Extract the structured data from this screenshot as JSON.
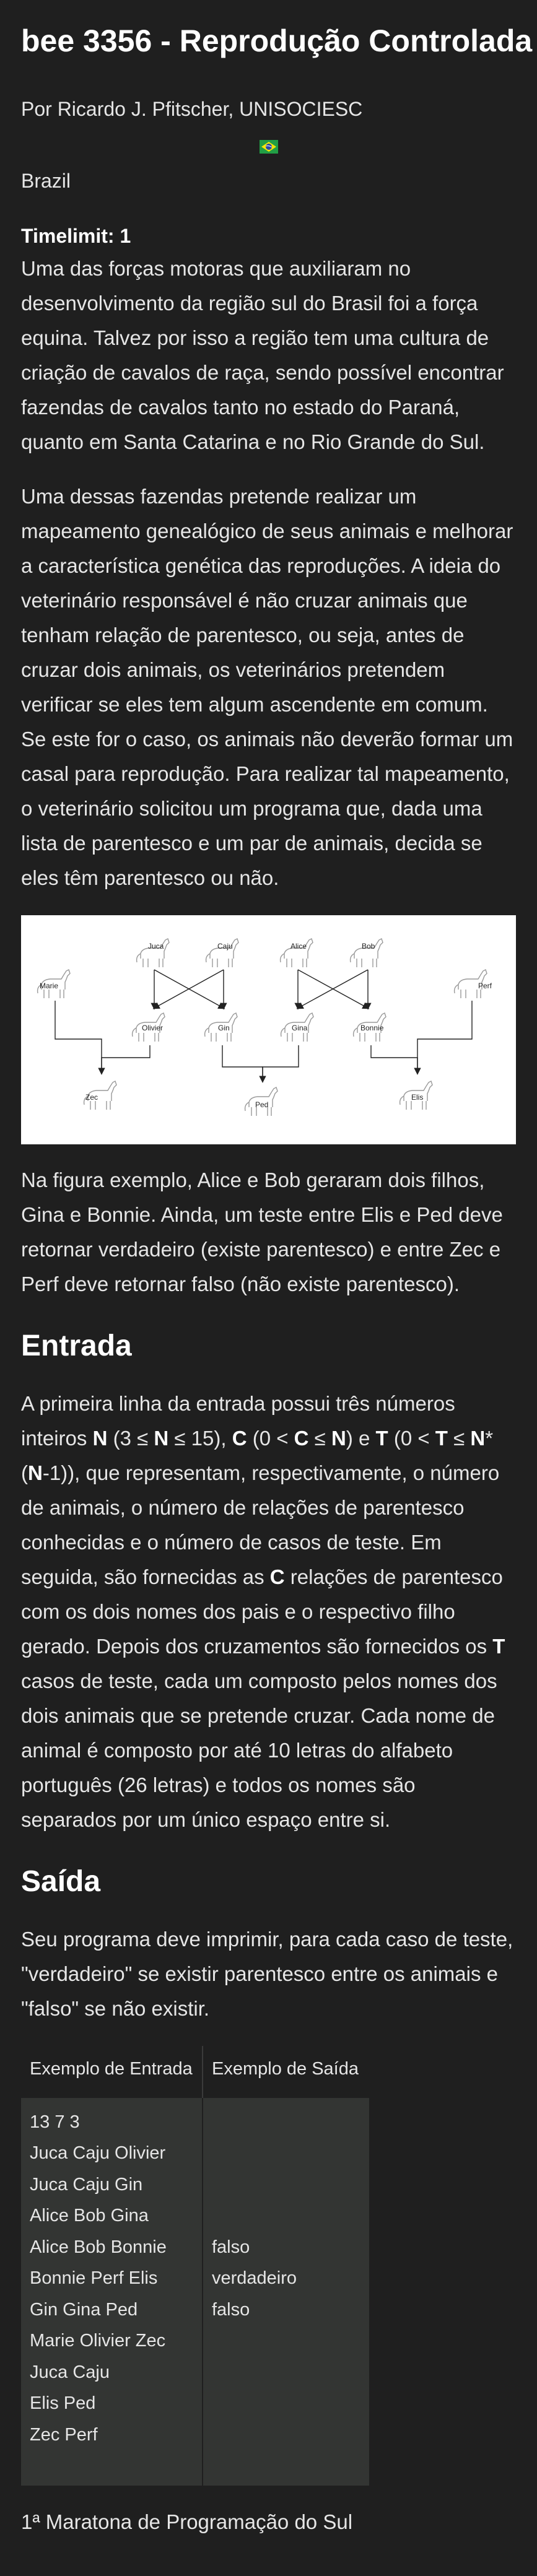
{
  "header": {
    "title": "bee 3356 - Reprodução Controlada",
    "author": "Por Ricardo J. Pfitscher, UNISOCIESC",
    "country": "Brazil",
    "timelimit": "Timelimit: 1"
  },
  "description": {
    "p1": "Uma das forças motoras que auxiliaram no desenvolvimento da região sul do Brasil foi a força equina. Talvez por isso a região tem uma cultura de criação de cavalos de raça, sendo possível encontrar fazendas de cavalos tanto no estado do Paraná, quanto em Santa Catarina e no Rio Grande do Sul.",
    "p2": "Uma dessas fazendas pretende realizar um mapeamento genealógico de seus animais e melhorar a característica genética das reproduções. A ideia do veterinário responsável é não cruzar animais que tenham relação de parentesco, ou seja, antes de cruzar dois animais, os veterinários pretendem verificar se eles tem algum ascendente em comum. Se este for o caso, os animais não deverão formar um casal para reprodução. Para realizar tal mapeamento, o veterinário solicitou um programa que, dada uma lista de parentesco e um par de animais, decida se eles têm parentesco ou não.",
    "p3": "Na figura exemplo, Alice e Bob geraram dois filhos, Gina e Bonnie. Ainda, um teste entre Elis e Ped deve retornar verdadeiro (existe parentesco) e entre Zec e Perf deve retornar falso (não existe parentesco)."
  },
  "figure": {
    "names": {
      "juca": "Juca",
      "caju": "Caju",
      "alice": "Alice",
      "bob": "Bob",
      "marie": "Marie",
      "perf": "Perf",
      "olivier": "Olivier",
      "gin": "Gin",
      "gina": "Gina",
      "bonnie": "Bonnie",
      "zec": "Zec",
      "ped": "Ped",
      "elis": "Elis"
    }
  },
  "input": {
    "title": "Entrada",
    "t1": "A primeira linha da entrada possui três números inteiros ",
    "n1": "N",
    "t2": " (3 ≤ ",
    "n2": "N",
    "t3": " ≤ 15), ",
    "c1": "C",
    "t4": " (0 < ",
    "c2": "C",
    "t5": " ≤ ",
    "n3": "N",
    "t6": ") e ",
    "tt1": "T",
    "t7": " (0 < ",
    "tt2": "T",
    "t8": " ≤ ",
    "n4": "N",
    "t9": "*(",
    "n5": "N",
    "t10": "-1)), que representam, respectivamente, o número de animais, o número de relações de parentesco conhecidas e o número de casos de teste. Em seguida, são fornecidas as ",
    "c3": "C",
    "t11": " relações de parentesco com os dois nomes dos pais e o respectivo filho gerado. Depois dos cruzamentos são fornecidos os ",
    "tt3": "T",
    "t12": " casos de teste, cada um composto pelos nomes dos dois animais que se pretende cruzar. Cada nome de animal é composto por até 10 letras do alfabeto português (26 letras) e todos os nomes são separados por um único espaço entre si."
  },
  "output": {
    "title": "Saída",
    "text": "Seu programa deve imprimir, para cada caso de teste, \"verdadeiro\" se existir parentesco entre os animais e \"falso\" se não existir."
  },
  "example": {
    "input_header": "Exemplo de Entrada",
    "output_header": "Exemplo de Saída",
    "input_text": "13 7 3\nJuca Caju Olivier\nJuca Caju Gin\nAlice Bob Gina\nAlice Bob Bonnie\nBonnie Perf Elis\nGin Gina Ped\nMarie Olivier Zec\nJuca Caju\nElis Ped\nZec Perf",
    "output_text": "\n\n\n\nfalso\nverdadeiro\nfalso"
  },
  "footer": {
    "text": "1ª Maratona de Programação do Sul"
  },
  "colors": {
    "background": "#1f1f1f",
    "text": "#e6e6e6",
    "table_cell": "#333533"
  }
}
